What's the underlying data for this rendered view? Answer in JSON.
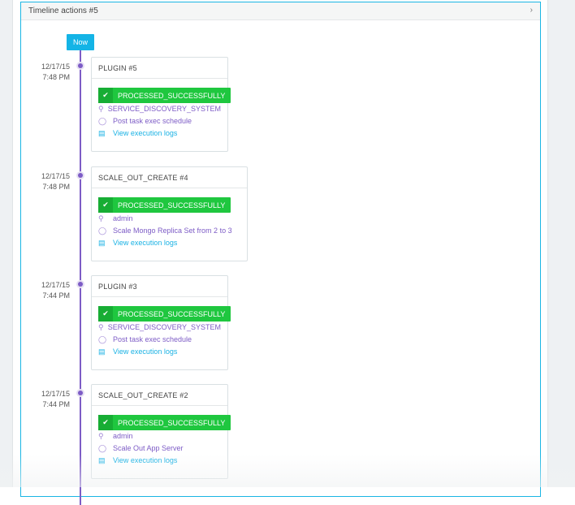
{
  "panel": {
    "title": "Timeline actions #5"
  },
  "timeline": {
    "now_label": "Now",
    "entries": [
      {
        "date": "12/17/15",
        "time": "7:48 PM",
        "title": "PLUGIN  #5",
        "status": "PROCESSED_SUCCESSFULLY",
        "user": "SERVICE_DISCOVERY_SYSTEM",
        "message": "Post task exec schedule",
        "logs_link": "View execution logs"
      },
      {
        "date": "12/17/15",
        "time": "7:48 PM",
        "title": "SCALE_OUT_CREATE  #4",
        "status": "PROCESSED_SUCCESSFULLY",
        "user": "admin",
        "message": "Scale Mongo Replica Set from 2 to 3",
        "logs_link": "View execution logs"
      },
      {
        "date": "12/17/15",
        "time": "7:44 PM",
        "title": "PLUGIN  #3",
        "status": "PROCESSED_SUCCESSFULLY",
        "user": "SERVICE_DISCOVERY_SYSTEM",
        "message": "Post task exec schedule",
        "logs_link": "View execution logs"
      },
      {
        "date": "12/17/15",
        "time": "7:44 PM",
        "title": "SCALE_OUT_CREATE  #2",
        "status": "PROCESSED_SUCCESSFULLY",
        "user": "admin",
        "message": "Scale Out App Server",
        "logs_link": "View execution logs"
      }
    ]
  },
  "colors": {
    "accent": "#14b4e6",
    "timeline": "#7d5cc6",
    "success": "#1fc73f"
  }
}
